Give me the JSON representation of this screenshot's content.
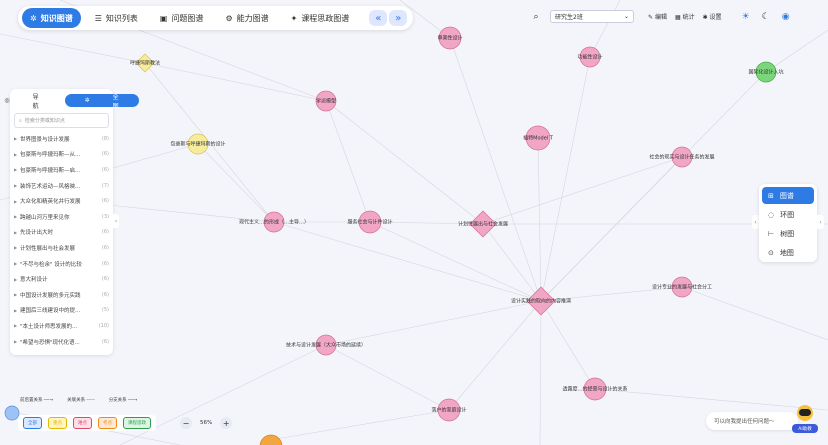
{
  "nav": {
    "tabs": [
      {
        "label": "知识图谱",
        "icon": "graph-icon"
      },
      {
        "label": "知识列表",
        "icon": "list-icon"
      },
      {
        "label": "问题图谱",
        "icon": "question-icon"
      },
      {
        "label": "能力图谱",
        "icon": "ability-icon"
      },
      {
        "label": "课程思政图谱",
        "icon": "course-icon"
      }
    ],
    "collapse_left": "«",
    "collapse_right": "»"
  },
  "topbar": {
    "select_value": "研究生2班",
    "edit_label": "编辑",
    "stats_label": "统计",
    "settings_label": "设置"
  },
  "left_panel": {
    "toggle": [
      {
        "label": "导航"
      },
      {
        "label": "全图"
      }
    ],
    "search_placeholder": "检索分类或知识点",
    "items": [
      {
        "label": "世界图景与设计发展",
        "count": "(8)"
      },
      {
        "label": "包豪斯与呼捷玛斯—从...",
        "count": "(6)"
      },
      {
        "label": "包豪斯与呼捷玛斯—启...",
        "count": "(6)"
      },
      {
        "label": "装饰艺术运动—风格映...",
        "count": "(7)"
      },
      {
        "label": "大众化和精英化并行发展",
        "count": "(6)"
      },
      {
        "label": "跨越山河万里来见你",
        "count": "(3)"
      },
      {
        "label": "先设计出大时",
        "count": "(6)"
      },
      {
        "label": "计划性展出与社会发展",
        "count": "(6)"
      },
      {
        "label": "\"不尽与检余\" 设计的比较",
        "count": "(6)"
      },
      {
        "label": "意大利设计",
        "count": "(6)"
      },
      {
        "label": "中国设计发展的多元实践",
        "count": "(6)"
      },
      {
        "label": "建国后三线建设中的提...",
        "count": "(5)"
      },
      {
        "label": "\"本土设计师思发展的...",
        "count": "(10)"
      },
      {
        "label": "\"希望与恐惧\"现代化语...",
        "count": "(6)"
      }
    ]
  },
  "views": [
    {
      "label": "图谱",
      "icon": "graph-view-icon"
    },
    {
      "label": "环图",
      "icon": "ring-view-icon"
    },
    {
      "label": "树图",
      "icon": "tree-view-icon"
    },
    {
      "label": "地图",
      "icon": "map-view-icon"
    }
  ],
  "edge_legend": [
    "前后置关系",
    "关联关系",
    "分支关系"
  ],
  "node_legend": [
    {
      "label": "全部",
      "color": "#2f7be6",
      "bg": "#dbe8ff"
    },
    {
      "label": "重点",
      "color": "#e5b800",
      "bg": "#fff4c2"
    },
    {
      "label": "难点",
      "color": "#e04a6a",
      "bg": "#ffe0e8"
    },
    {
      "label": "考点",
      "color": "#f08a1a",
      "bg": "#ffe8d2"
    },
    {
      "label": "课程思政",
      "color": "#2e9e4e",
      "bg": "#dcf5e2"
    }
  ],
  "zoom": {
    "minus": "−",
    "value": "56%",
    "plus": "+"
  },
  "ask": {
    "placeholder": "可以向我提出任何问题～",
    "ai_label": "AI助教"
  },
  "graph": {
    "nodes": [
      {
        "id": "n1",
        "label": "审美性设计",
        "color": "#f0a6c4",
        "stroke": "#d4708f",
        "shape": "circle"
      },
      {
        "id": "n2",
        "label": "呼捷玛斯教法",
        "color": "#f6ec9f",
        "stroke": "#d9c24e",
        "shape": "diamond"
      },
      {
        "id": "n3",
        "label": "学派模型",
        "color": "#f0a6c4",
        "stroke": "#d4708f",
        "shape": "circle"
      },
      {
        "id": "n4",
        "label": "功能性设计",
        "color": "#f0a6c4",
        "stroke": "#d4708f",
        "shape": "circle"
      },
      {
        "id": "n5",
        "label": "国际化设计入坑",
        "color": "#7bd67b",
        "stroke": "#3fa83f",
        "shape": "circle"
      },
      {
        "id": "n6",
        "label": "包豪斯与呼捷玛斯的设计",
        "color": "#f6ec9f",
        "stroke": "#d9c24e",
        "shape": "circle"
      },
      {
        "id": "n7",
        "label": "福特Model T",
        "color": "#f0a6c4",
        "stroke": "#d4708f",
        "shape": "circle"
      },
      {
        "id": "n8",
        "label": "社会的现实与设计任务的发展",
        "color": "#f0a6c4",
        "stroke": "#d4708f",
        "shape": "circle"
      },
      {
        "id": "n9",
        "label": "现代主义…的形成（…主导…）",
        "color": "#f0a6c4",
        "stroke": "#d4708f",
        "shape": "circle"
      },
      {
        "id": "n10",
        "label": "服务社会与计件设计",
        "color": "#f0a6c4",
        "stroke": "#d4708f",
        "shape": "circle"
      },
      {
        "id": "n11",
        "label": "计划性展出与社会发展",
        "color": "#f0a6c4",
        "stroke": "#d4708f",
        "shape": "diamond"
      },
      {
        "id": "n12",
        "label": "设计专业的发展与社会分工",
        "color": "#f0a6c4",
        "stroke": "#d4708f",
        "shape": "circle"
      },
      {
        "id": "n13",
        "label": "设计实践的取向的内容推演",
        "color": "#f0a6c4",
        "stroke": "#d4708f",
        "shape": "diamond"
      },
      {
        "id": "n14",
        "label": "技术与设计发展（大众市场的延续）",
        "color": "#f0a6c4",
        "stroke": "#d4708f",
        "shape": "circle"
      },
      {
        "id": "n15",
        "label": "透露度…的经营与设计的关系",
        "color": "#f0a6c4",
        "stroke": "#d4708f",
        "shape": "circle"
      },
      {
        "id": "n16",
        "label": "落户的家庭设计",
        "color": "#f0a6c4",
        "stroke": "#d4708f",
        "shape": "circle"
      }
    ]
  }
}
